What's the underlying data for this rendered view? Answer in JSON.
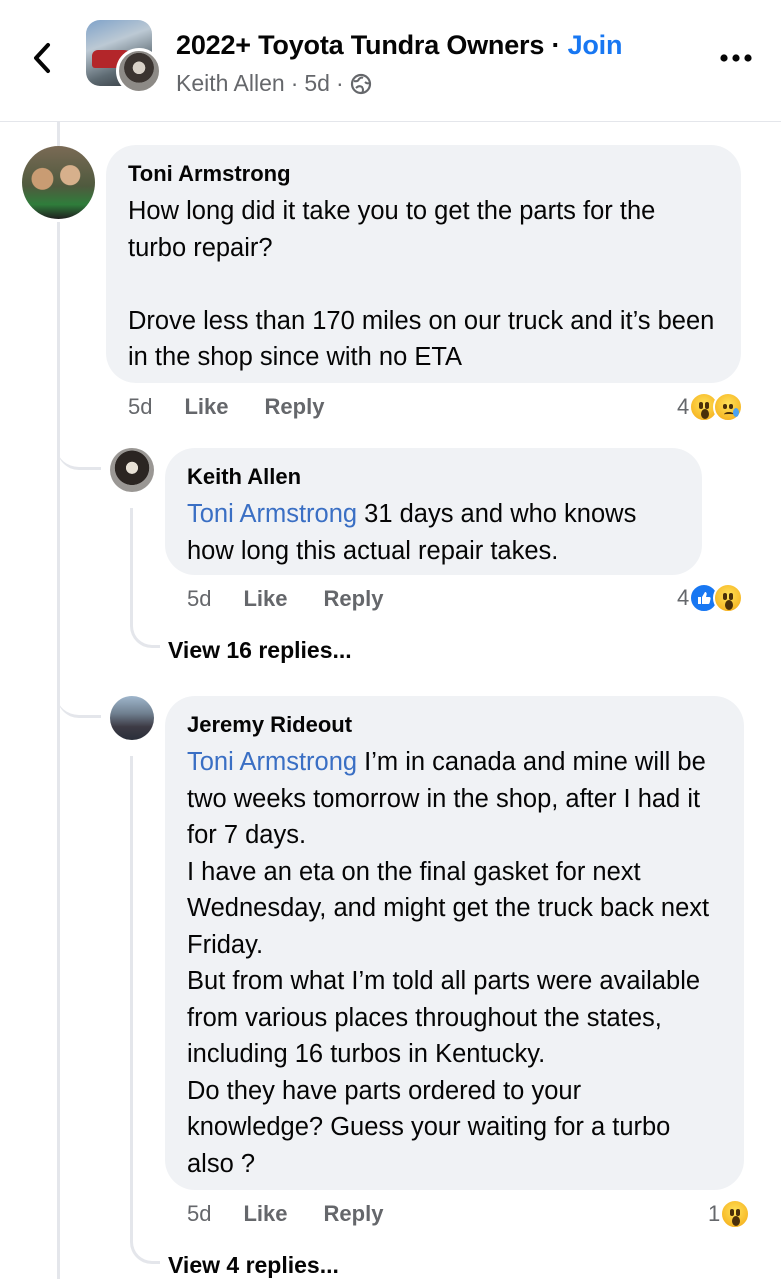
{
  "header": {
    "group_name": "2022+ Toyota Tundra Owners",
    "separator": " · ",
    "join_label": "Join",
    "poster_name": "Keith Allen",
    "post_age": "5d",
    "dot": "·",
    "icons": [
      "back-icon",
      "globe-icon",
      "more-icon"
    ]
  },
  "comments": [
    {
      "author": "Toni Armstrong",
      "mention": "",
      "text": "How long did it take you to get the parts for the turbo repair?\n\nDrove less than 170 miles on our truck and it’s been in the shop since with no ETA",
      "time": "5d",
      "like_label": "Like",
      "reply_label": "Reply",
      "reaction_count": "4",
      "reactions": [
        "wow",
        "sad"
      ]
    },
    {
      "author": "Keith Allen",
      "mention": "Toni Armstrong",
      "text": " 31 days and who knows how long this actual repair takes.",
      "time": "5d",
      "like_label": "Like",
      "reply_label": "Reply",
      "reaction_count": "4",
      "reactions": [
        "like",
        "wow"
      ],
      "view_replies": "View 16 replies..."
    },
    {
      "author": "Jeremy Rideout",
      "mention": "Toni Armstrong",
      "text": " I’m in canada and mine will be two weeks tomorrow in the shop, after I had it for 7 days.\nI have an eta on the final gasket for next Wednesday, and might get the truck back next Friday.\nBut from what I’m told all parts were available from various places throughout the states, including 16 turbos in Kentucky.\nDo they have parts ordered to your knowledge? Guess your waiting for a turbo also ?",
      "time": "5d",
      "like_label": "Like",
      "reply_label": "Reply",
      "reaction_count": "1",
      "reactions": [
        "wow"
      ],
      "view_replies": "View 4 replies..."
    }
  ],
  "colors": {
    "link_blue": "#1877f2",
    "mention_blue": "#3a6fc4",
    "bubble_bg": "#f0f2f5",
    "meta_gray": "#65676b"
  }
}
